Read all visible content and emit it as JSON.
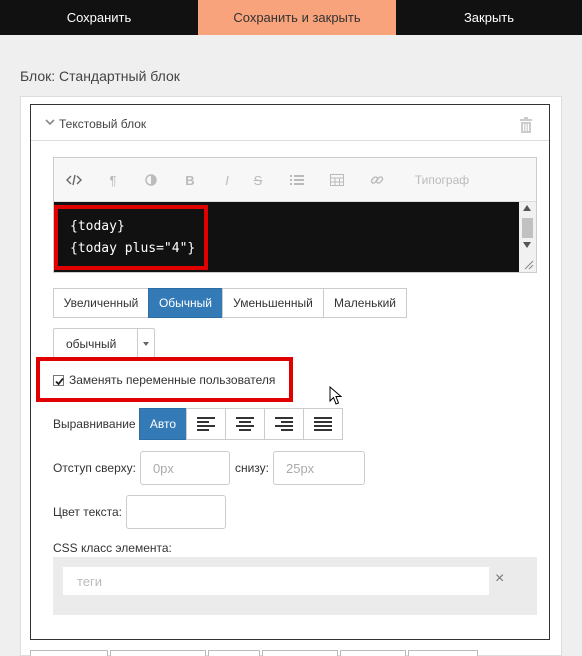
{
  "topbar": {
    "save": "Сохранить",
    "save_close": "Сохранить и закрыть",
    "close": "Закрыть"
  },
  "block_title": "Блок: Стандартный блок",
  "text_block": {
    "title": "Текстовый блок"
  },
  "editor": {
    "toolbar": {
      "typograph": "Типограф"
    },
    "code_lines": [
      "{today}",
      "{today plus=\"4\"}"
    ]
  },
  "sizes": [
    "Увеличенный",
    "Обычный",
    "Уменьшенный",
    "Маленький"
  ],
  "size_active_index": 1,
  "style_select": {
    "value": "обычный"
  },
  "replace_vars": {
    "label": "Заменять переменные пользователя",
    "checked": true
  },
  "alignment": {
    "label": "Выравнивание",
    "auto": "Авто"
  },
  "indent": {
    "top_label": "Отступ сверху:",
    "top_placeholder": "0px",
    "bottom_label": "снизу:",
    "bottom_placeholder": "25px"
  },
  "text_color": {
    "label": "Цвет текста:"
  },
  "css_class": {
    "label": "CSS класс элемента:",
    "placeholder": "теги",
    "clear": "×"
  },
  "colors": {
    "accent": "#337ab7",
    "highlight": "#e00000",
    "save_close_bg": "#f9a37c"
  }
}
